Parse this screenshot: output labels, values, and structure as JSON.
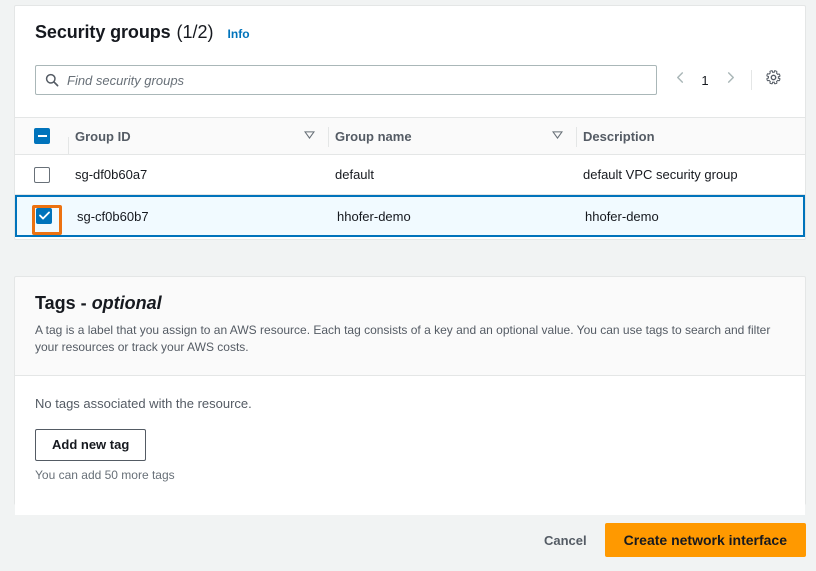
{
  "security_groups_card": {
    "title": "Security groups",
    "count": "(1/2)",
    "info_label": "Info",
    "search": {
      "placeholder": "Find security groups",
      "value": "",
      "icon": "search-icon"
    },
    "pagination": {
      "prev_icon": "chevron-left-icon",
      "page": "1",
      "next_icon": "chevron-right-icon",
      "settings_icon": "gear-icon"
    },
    "table": {
      "columns": [
        {
          "label": "Group ID",
          "sortable": true
        },
        {
          "label": "Group name",
          "sortable": true
        },
        {
          "label": "Description",
          "sortable": false
        }
      ],
      "header_checkbox_state": "indeterminate",
      "rows": [
        {
          "selected": false,
          "group_id": "sg-df0b60a7",
          "group_name": "default",
          "description": "default VPC security group"
        },
        {
          "selected": true,
          "group_id": "sg-cf0b60b7",
          "group_name": "hhofer-demo",
          "description": "hhofer-demo"
        }
      ]
    }
  },
  "tags_card": {
    "title": "Tags -",
    "title_optional": "optional",
    "description": "A tag is a label that you assign to an AWS resource. Each tag consists of a key and an optional value. You can use tags to search and filter your resources or track your AWS costs.",
    "empty_message": "No tags associated with the resource.",
    "add_tag_label": "Add new tag",
    "remaining_hint": "You can add 50 more tags"
  },
  "footer": {
    "cancel_label": "Cancel",
    "submit_label": "Create network interface"
  },
  "colors": {
    "primary_button": "#ff9900",
    "link": "#0073bb",
    "checkbox_checked": "#0073bb",
    "focus_ring": "#ec7211",
    "selected_row_bg": "#f1faff",
    "page_bg": "#f1f3f3"
  }
}
